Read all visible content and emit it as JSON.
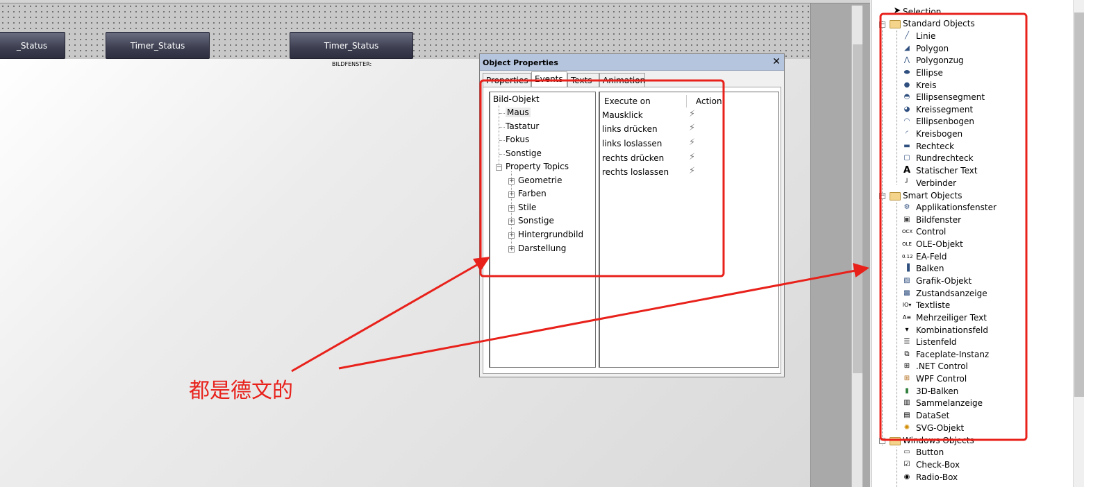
{
  "canvas": {
    "buttons": [
      "_Status",
      "Timer_Status",
      "Timer_Status"
    ],
    "bildfenster_label": "BILDFENSTER:"
  },
  "annotation": {
    "text": "都是德文的",
    "color": "#e8211b"
  },
  "dialog": {
    "title": "Object Properties",
    "close_glyph": "✕",
    "tabs": [
      "Properties",
      "Events",
      "Texts",
      "Animation"
    ],
    "active_tab": "Events",
    "tree": {
      "root": "Bild-Objekt",
      "children": [
        "Maus",
        "Tastatur",
        "Fokus",
        "Sonstige"
      ],
      "property_topics": "Property Topics",
      "topics": [
        "Geometrie",
        "Farben",
        "Stile",
        "Sonstige",
        "Hintergrundbild",
        "Darstellung"
      ]
    },
    "events": {
      "col_execute": "Execute on",
      "col_action": "Action",
      "rows": [
        "Mausklick",
        "links drücken",
        "links loslassen",
        "rechts drücken",
        "rechts loslassen"
      ],
      "action_glyph": "⚡"
    }
  },
  "palette": {
    "selection": "Selection",
    "standard_group": "Standard Objects",
    "standard_items": [
      "Linie",
      "Polygon",
      "Polygonzug",
      "Ellipse",
      "Kreis",
      "Ellipsensegment",
      "Kreissegment",
      "Ellipsenbogen",
      "Kreisbogen",
      "Rechteck",
      "Rundrechteck",
      "Statischer Text",
      "Verbinder"
    ],
    "smart_group": "Smart Objects",
    "smart_items": [
      "Applikationsfenster",
      "Bildfenster",
      "Control",
      "OLE-Objekt",
      "EA-Feld",
      "Balken",
      "Grafik-Objekt",
      "Zustandsanzeige",
      "Textliste",
      "Mehrzeiliger Text",
      "Kombinationsfeld",
      "Listenfeld",
      "Faceplate-Instanz",
      ".NET Control",
      "WPF Control",
      "3D-Balken",
      "Sammelanzeige",
      "DataSet",
      "SVG-Objekt"
    ],
    "windows_group": "Windows Objects",
    "windows_items": [
      "Button",
      "Check-Box",
      "Radio-Box"
    ]
  }
}
